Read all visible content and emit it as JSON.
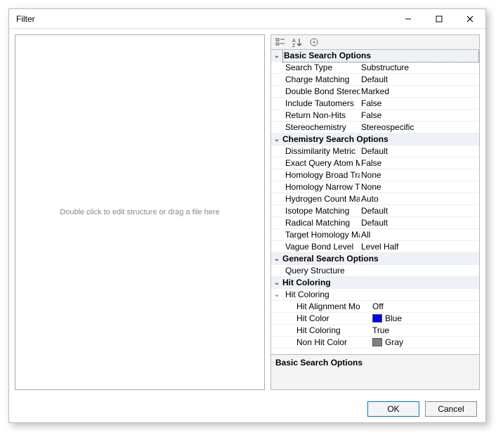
{
  "window": {
    "title": "Filter"
  },
  "leftpane": {
    "placeholder": "Double click to edit structure or drag a file here"
  },
  "categories": {
    "basic": {
      "label": "Basic Search Options",
      "props": {
        "search_type": {
          "name": "Search Type",
          "value": "Substructure"
        },
        "charge_matching": {
          "name": "Charge Matching",
          "value": "Default"
        },
        "double_bond_stereo": {
          "name": "Double Bond Stereo C",
          "value": "Marked"
        },
        "include_tautomers": {
          "name": "Include Tautomers",
          "value": "False"
        },
        "return_non_hits": {
          "name": "Return Non-Hits",
          "value": "False"
        },
        "stereochemistry": {
          "name": "Stereochemistry",
          "value": "Stereospecific"
        }
      }
    },
    "chemistry": {
      "label": "Chemistry Search Options",
      "props": {
        "dissimilarity_metric": {
          "name": "Dissimilarity Metric",
          "value": "Default"
        },
        "exact_query_atom": {
          "name": "Exact Query Atom Ma",
          "value": "False"
        },
        "homology_broad": {
          "name": "Homology Broad Tran",
          "value": "None"
        },
        "homology_narrow": {
          "name": "Homology Narrow Tr",
          "value": "None"
        },
        "hydrogen_count": {
          "name": "Hydrogen Count Matc",
          "value": "Auto"
        },
        "isotope_matching": {
          "name": "Isotope Matching",
          "value": "Default"
        },
        "radical_matching": {
          "name": "Radical Matching",
          "value": "Default"
        },
        "target_homology": {
          "name": "Target Homology Mat",
          "value": "All"
        },
        "vague_bond": {
          "name": "Vague Bond Level",
          "value": "Level Half"
        }
      }
    },
    "general": {
      "label": "General Search Options",
      "props": {
        "query_structure": {
          "name": "Query Structure",
          "value": ""
        }
      }
    },
    "hit_coloring": {
      "label": "Hit Coloring",
      "sub": {
        "label": "Hit Coloring",
        "props": {
          "hit_alignment": {
            "name": "Hit Alignment Mo",
            "value": "Off"
          },
          "hit_color": {
            "name": "Hit Color",
            "value": "Blue",
            "swatch": "#0000ff"
          },
          "hit_coloring": {
            "name": "Hit Coloring",
            "value": "True"
          },
          "non_hit_color": {
            "name": "Non Hit Color",
            "value": "Gray",
            "swatch": "#808080"
          }
        }
      }
    }
  },
  "description": {
    "title": "Basic Search Options"
  },
  "buttons": {
    "ok": "OK",
    "cancel": "Cancel"
  }
}
